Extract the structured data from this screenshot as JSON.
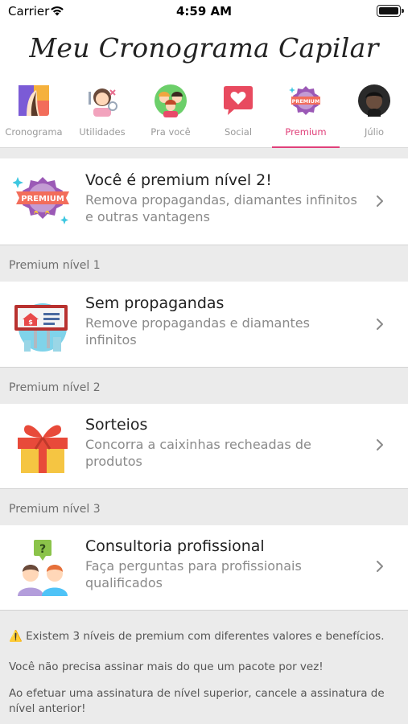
{
  "status_bar": {
    "carrier": "Carrier",
    "time": "4:59 AM"
  },
  "header": {
    "title": "Meu Cronograma Capilar"
  },
  "tabs": [
    {
      "label": "Cronograma",
      "icon": "cronograma-icon",
      "active": false
    },
    {
      "label": "Utilidades",
      "icon": "utilities-icon",
      "active": false
    },
    {
      "label": "Pra você",
      "icon": "for-you-icon",
      "active": false
    },
    {
      "label": "Social",
      "icon": "social-icon",
      "active": false
    },
    {
      "label": "Premium",
      "icon": "premium-icon",
      "active": true
    },
    {
      "label": "Júlio",
      "icon": "profile-avatar",
      "active": false
    }
  ],
  "premium_status": {
    "title": "Você é premium nível 2!",
    "subtitle": "Remova propagandas, diamantes infinitos e outras vantagens",
    "icon": "premium-badge-icon"
  },
  "sections": [
    {
      "header": "Premium nível 1",
      "item": {
        "title": "Sem propagandas",
        "subtitle": "Remove propagandas e diamantes infinitos",
        "icon": "no-ads-billboard-icon"
      }
    },
    {
      "header": "Premium nível 2",
      "item": {
        "title": "Sorteios",
        "subtitle": "Concorra a caixinhas recheadas de produtos",
        "icon": "gift-box-icon"
      }
    },
    {
      "header": "Premium nível 3",
      "item": {
        "title": "Consultoria profissional",
        "subtitle": "Faça perguntas para profissionais qualificados",
        "icon": "consulting-people-icon"
      }
    }
  ],
  "footer": {
    "warning_icon": "⚠️",
    "line1": "Existem 3 níveis de premium com diferentes valores e benefícios.",
    "line2": "Você não precisa assinar mais do que um pacote por vez!",
    "line3": "Ao efetuar uma assinatura de nível superior, cancele a assinatura de nível anterior!"
  },
  "colors": {
    "accent": "#e0407a",
    "background": "#ebebeb",
    "card": "#ffffff",
    "secondary_text": "#8a8a8a"
  }
}
